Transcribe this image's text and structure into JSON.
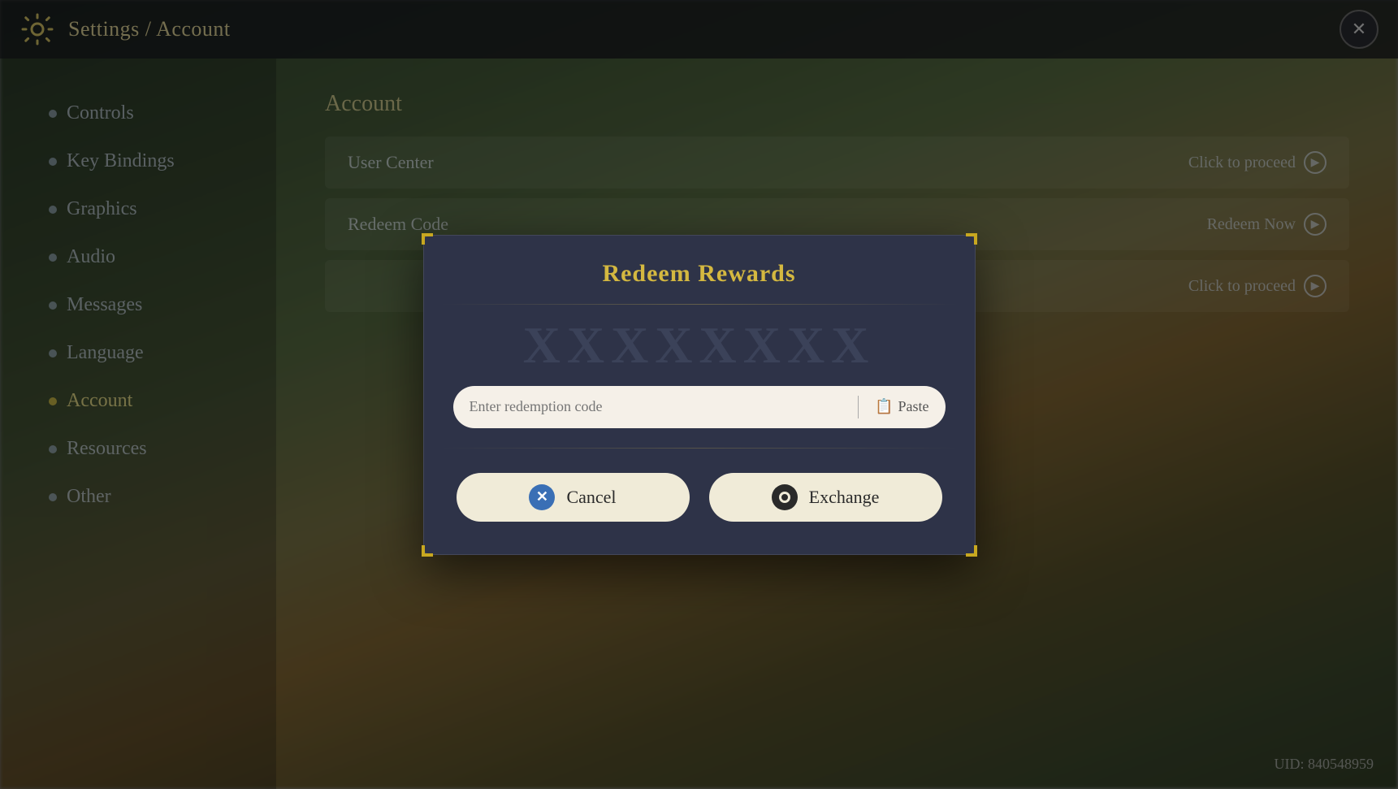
{
  "topbar": {
    "breadcrumb": "Settings / Account",
    "close_label": "✕"
  },
  "sidebar": {
    "items": [
      {
        "id": "controls",
        "label": "Controls",
        "active": false
      },
      {
        "id": "key-bindings",
        "label": "Key Bindings",
        "active": false
      },
      {
        "id": "graphics",
        "label": "Graphics",
        "active": false
      },
      {
        "id": "audio",
        "label": "Audio",
        "active": false
      },
      {
        "id": "messages",
        "label": "Messages",
        "active": false
      },
      {
        "id": "language",
        "label": "Language",
        "active": false
      },
      {
        "id": "account",
        "label": "Account",
        "active": true
      },
      {
        "id": "resources",
        "label": "Resources",
        "active": false
      },
      {
        "id": "other",
        "label": "Other",
        "active": false
      }
    ]
  },
  "main": {
    "section_title": "Account",
    "rows": [
      {
        "id": "user-center",
        "label": "User Center",
        "action": "Click to proceed"
      },
      {
        "id": "redeem-code",
        "label": "Redeem Code",
        "action": "Redeem Now"
      },
      {
        "id": "third-party",
        "label": "",
        "action": "Click to proceed"
      }
    ]
  },
  "modal": {
    "title": "Redeem Rewards",
    "watermark": "XXXXXXXX",
    "input_placeholder": "Enter redemption code",
    "paste_label": "Paste",
    "cancel_label": "Cancel",
    "exchange_label": "Exchange"
  },
  "uid": {
    "label": "UID: 840548959"
  }
}
